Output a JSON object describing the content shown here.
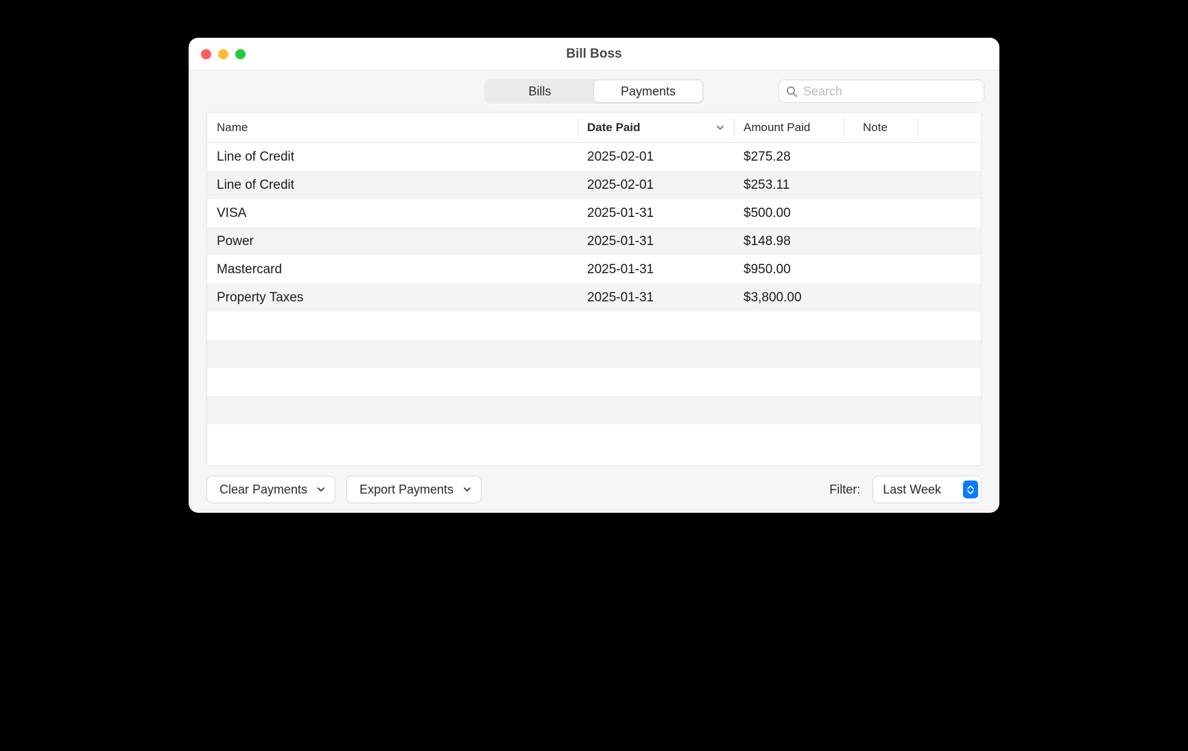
{
  "window": {
    "title": "Bill Boss"
  },
  "tabs": {
    "bills": "Bills",
    "payments": "Payments",
    "active": "payments"
  },
  "search": {
    "placeholder": "Search",
    "value": ""
  },
  "columns": {
    "name": "Name",
    "date": "Date Paid",
    "amount": "Amount Paid",
    "note": "Note",
    "sorted": "date",
    "sort_dir": "desc"
  },
  "rows": [
    {
      "name": "Line of Credit",
      "date": "2025-02-01",
      "amount": "$275.28",
      "note": ""
    },
    {
      "name": "Line of Credit",
      "date": "2025-02-01",
      "amount": "$253.11",
      "note": ""
    },
    {
      "name": "VISA",
      "date": "2025-01-31",
      "amount": "$500.00",
      "note": ""
    },
    {
      "name": "Power",
      "date": "2025-01-31",
      "amount": "$148.98",
      "note": ""
    },
    {
      "name": "Mastercard",
      "date": "2025-01-31",
      "amount": "$950.00",
      "note": ""
    },
    {
      "name": "Property Taxes",
      "date": "2025-01-31",
      "amount": "$3,800.00",
      "note": ""
    }
  ],
  "footer": {
    "clear": "Clear Payments",
    "export": "Export Payments",
    "filter_label": "Filter:",
    "filter_value": "Last Week"
  }
}
